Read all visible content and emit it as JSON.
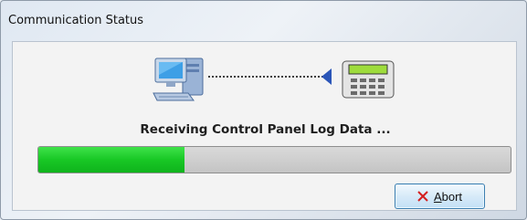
{
  "window": {
    "title": "Communication Status"
  },
  "status": {
    "message": "Receiving Control Panel Log Data ..."
  },
  "progress": {
    "value_percent": 31
  },
  "buttons": {
    "abort_label": "Abort"
  },
  "colors": {
    "progress_fill": "#18c825",
    "arrow": "#2a55b8",
    "device_display": "#9edc3c"
  },
  "icons": {
    "computer": "computer-icon",
    "control_panel": "control-panel-keypad-icon",
    "abort": "close-x-icon"
  }
}
